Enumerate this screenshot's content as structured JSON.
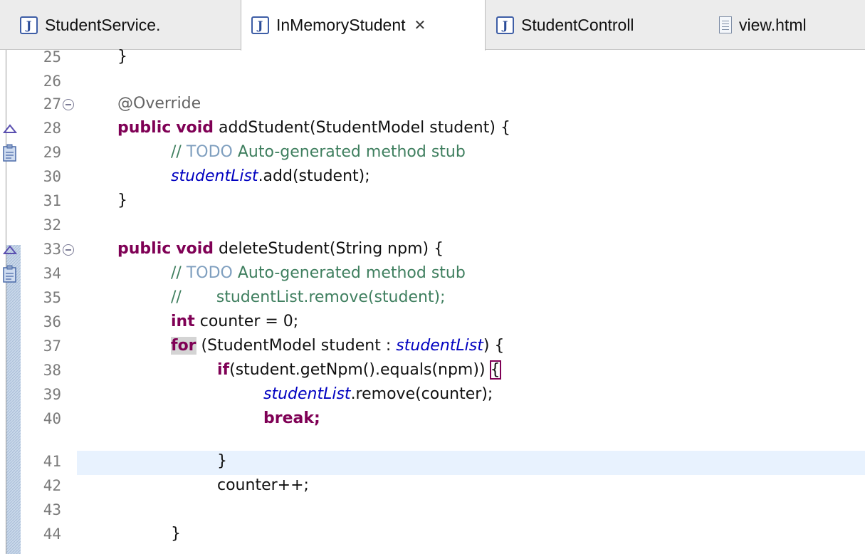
{
  "tabs": [
    {
      "label": "StudentService.",
      "icon": "java-file-icon",
      "active": false
    },
    {
      "label": "InMemoryStudent",
      "icon": "java-file-icon",
      "active": true,
      "close": "✕"
    },
    {
      "label": "StudentControll",
      "icon": "java-file-icon",
      "active": false
    },
    {
      "label": "view.html",
      "icon": "html-file-icon",
      "active": false
    }
  ],
  "editor": {
    "highlighted_line": "41",
    "lines": [
      {
        "num": "25",
        "text": "}"
      },
      {
        "num": "26",
        "text": ""
      },
      {
        "num": "27",
        "text": "@Override"
      },
      {
        "num": "28",
        "text": "public void addStudent(StudentModel student) {"
      },
      {
        "num": "29",
        "text": "// TODO Auto-generated method stub"
      },
      {
        "num": "30",
        "text": "studentList.add(student);"
      },
      {
        "num": "31",
        "text": "}"
      },
      {
        "num": "32",
        "text": ""
      },
      {
        "num": "33",
        "text": "public void deleteStudent(String npm) {"
      },
      {
        "num": "34",
        "text": "// TODO Auto-generated method stub"
      },
      {
        "num": "35",
        "text": "//       studentList.remove(student);"
      },
      {
        "num": "36",
        "text": "int counter = 0;"
      },
      {
        "num": "37",
        "text": "for (StudentModel student : studentList) {"
      },
      {
        "num": "38",
        "text": "if(student.getNpm().equals(npm)) {"
      },
      {
        "num": "39",
        "text": "studentList.remove(counter);"
      },
      {
        "num": "40",
        "text": "break;"
      },
      {
        "num": "41",
        "text": "}"
      },
      {
        "num": "42",
        "text": "counter++;"
      },
      {
        "num": "43",
        "text": ""
      },
      {
        "num": "44",
        "text": "}"
      }
    ]
  },
  "tokens": {
    "l25": "}",
    "l27": "@Override",
    "l28": [
      "public",
      "void",
      " addStudent(StudentModel student) {"
    ],
    "l29": [
      "// ",
      "TODO",
      " Auto-generated method stub"
    ],
    "l30": [
      "studentList",
      ".add(student);"
    ],
    "l31": "}",
    "l33": [
      "public",
      "void",
      " deleteStudent(String npm) {"
    ],
    "l34": [
      "// ",
      "TODO",
      " Auto-generated method stub"
    ],
    "l35": "//       studentList.remove(student);",
    "l36": [
      "int",
      " counter = 0;"
    ],
    "l37": [
      "for",
      " (StudentModel student : ",
      "studentList",
      ") {"
    ],
    "l38": [
      "if",
      "(student.getNpm().equals(npm)) ",
      "{"
    ],
    "l39": [
      "studentList",
      ".remove(counter);"
    ],
    "l40": "break;",
    "l41": "}",
    "l42": "counter++;",
    "l44": "}"
  },
  "colors": {
    "keyword": "#7f0055",
    "comment": "#3f7f5f",
    "todo": "#7f9fbf",
    "field": "#0000c0",
    "annotation": "#646464",
    "current_line": "#e8f2fe",
    "change_ruler": "#bfcfe4"
  }
}
